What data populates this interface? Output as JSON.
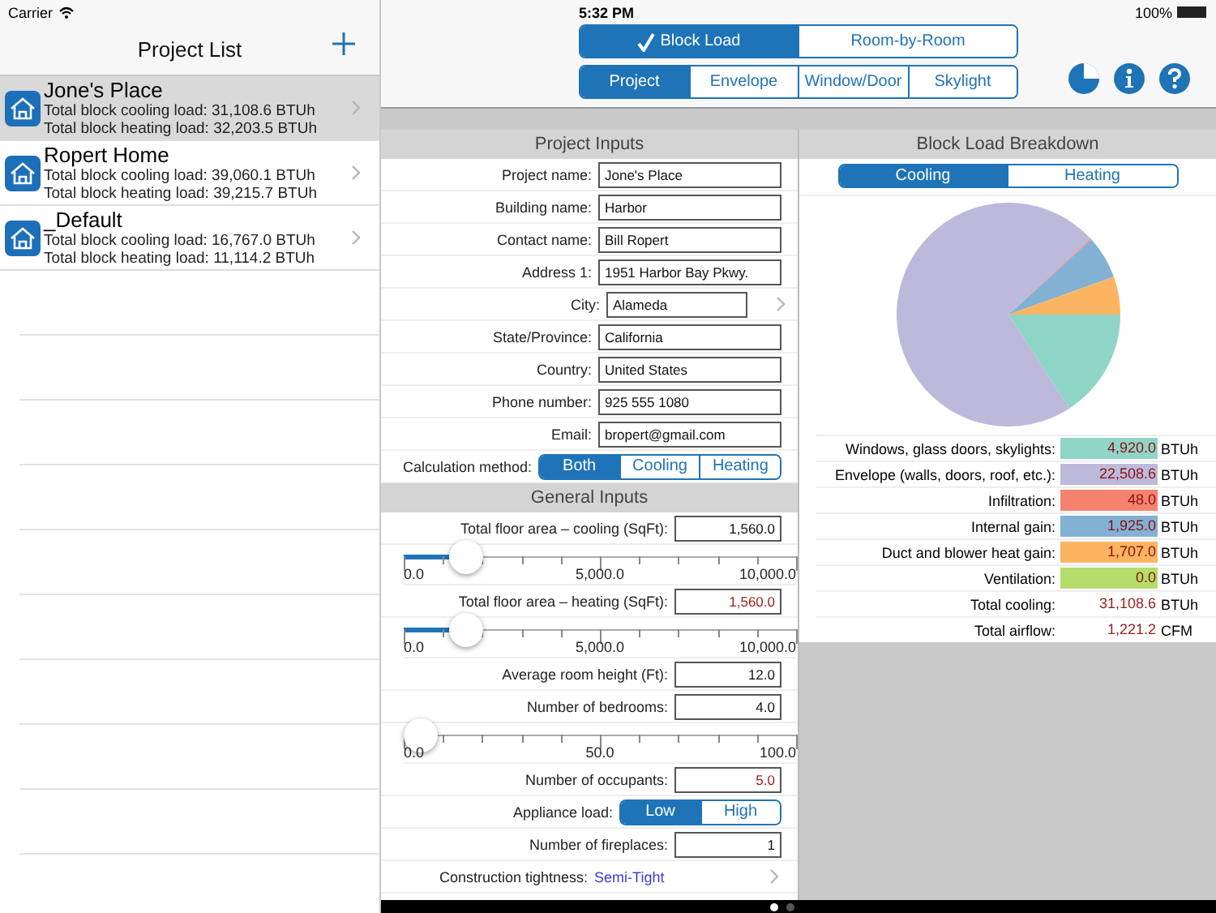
{
  "status_bar": {
    "carrier": "Carrier",
    "time": "5:32 PM",
    "battery": "100%"
  },
  "project_list": {
    "title": "Project List",
    "projects": [
      {
        "name": "Jone's Place",
        "cooling": "Total block cooling load: 31,108.6 BTUh",
        "heating": "Total block heating load: 32,203.5 BTUh",
        "selected": true
      },
      {
        "name": "Ropert Home",
        "cooling": "Total block cooling load: 39,060.1 BTUh",
        "heating": "Total block heating load: 39,215.7 BTUh",
        "selected": false
      },
      {
        "name": "_Default",
        "cooling": "Total block cooling load: 16,767.0 BTUh",
        "heating": "Total block heating load: 11,114.2 BTUh",
        "selected": false
      }
    ]
  },
  "mode_tabs": [
    {
      "label": "Block Load",
      "selected": true
    },
    {
      "label": "Room-by-Room",
      "selected": false
    }
  ],
  "section_tabs": [
    {
      "label": "Project",
      "selected": true
    },
    {
      "label": "Envelope",
      "selected": false
    },
    {
      "label": "Window/Door",
      "selected": false
    },
    {
      "label": "Skylight",
      "selected": false
    }
  ],
  "project_inputs": {
    "title": "Project Inputs",
    "fields": [
      {
        "kind": "text",
        "label": "Project name:",
        "value": "Jone's Place"
      },
      {
        "kind": "text",
        "label": "Building name:",
        "value": "Harbor"
      },
      {
        "kind": "text",
        "label": "Contact name:",
        "value": "Bill Ropert"
      },
      {
        "kind": "text",
        "label": "Address 1:",
        "value": "1951 Harbor Bay Pkwy."
      },
      {
        "kind": "picker",
        "label": "City:",
        "value": "Alameda"
      },
      {
        "kind": "text",
        "label": "State/Province:",
        "value": "California"
      },
      {
        "kind": "text",
        "label": "Country:",
        "value": "United States"
      },
      {
        "kind": "text",
        "label": "Phone number:",
        "value": "925 555 1080"
      },
      {
        "kind": "text",
        "label": "Email:",
        "value": "bropert@gmail.com"
      },
      {
        "kind": "segmented",
        "label": "Calculation method:",
        "options": [
          {
            "label": "Both",
            "selected": true
          },
          {
            "label": "Cooling",
            "selected": false
          },
          {
            "label": "Heating",
            "selected": false
          }
        ]
      }
    ]
  },
  "general_inputs": {
    "title": "General Inputs",
    "fields": [
      {
        "kind": "number",
        "label": "Total floor area – cooling (SqFt):",
        "value": "1,560.0",
        "derived": false
      },
      {
        "kind": "slider",
        "level": 0.156,
        "ticks": [
          "0.0",
          "5,000.0",
          "10,000.0"
        ]
      },
      {
        "kind": "number",
        "label": "Total floor area – heating (SqFt):",
        "value": "1,560.0",
        "derived": true
      },
      {
        "kind": "slider",
        "level": 0.156,
        "ticks": [
          "0.0",
          "5,000.0",
          "10,000.0"
        ]
      },
      {
        "kind": "number",
        "label": "Average room height (Ft):",
        "value": "12.0",
        "derived": false
      },
      {
        "kind": "number",
        "label": "Number of bedrooms:",
        "value": "4.0",
        "derived": false
      },
      {
        "kind": "slider",
        "level": 0.04,
        "ticks": [
          "0.0",
          "50.0",
          "100.0"
        ]
      },
      {
        "kind": "number",
        "label": "Number of occupants:",
        "value": "5.0",
        "derived": true
      },
      {
        "kind": "segmented",
        "label": "Appliance load:",
        "options": [
          {
            "label": "Low",
            "selected": true
          },
          {
            "label": "High",
            "selected": false
          }
        ]
      },
      {
        "kind": "number",
        "label": "Number of fireplaces:",
        "value": "1",
        "derived": false
      },
      {
        "kind": "link",
        "label": "Construction tightness:",
        "value": "Semi-Tight"
      }
    ]
  },
  "breakdown": {
    "title": "Block Load Breakdown",
    "tabs": [
      {
        "label": "Cooling",
        "selected": true
      },
      {
        "label": "Heating",
        "selected": false
      }
    ],
    "chart_data": {
      "type": "pie",
      "values": [
        15.816,
        72.355,
        0.154,
        6.188,
        5.487,
        0.0
      ]
    },
    "rows": [
      {
        "kind": "item",
        "label": "Windows, glass doors, skylights:",
        "value": "4,920.0",
        "unit": "BTUh",
        "color": "#8fd5c8"
      },
      {
        "kind": "item",
        "label": "Envelope (walls, doors, roof, etc.):",
        "value": "22,508.6",
        "unit": "BTUh",
        "color": "#bdb9da"
      },
      {
        "kind": "item",
        "label": "Infiltration:",
        "value": "48.0",
        "unit": "BTUh",
        "color": "#f5816f"
      },
      {
        "kind": "item",
        "label": "Internal gain:",
        "value": "1,925.0",
        "unit": "BTUh",
        "color": "#82b1d4"
      },
      {
        "kind": "item",
        "label": "Duct and blower heat gain:",
        "value": "1,707.0",
        "unit": "BTUh",
        "color": "#fbb462"
      },
      {
        "kind": "item",
        "label": "Ventilation:",
        "value": "0.0",
        "unit": "BTUh",
        "color": "#b4dd6c"
      },
      {
        "kind": "total",
        "label": "Total cooling:",
        "value": "31,108.6",
        "unit": "BTUh"
      },
      {
        "kind": "total",
        "label": "Total airflow:",
        "value": "1,221.2",
        "unit": "CFM"
      }
    ]
  },
  "pager": [
    {
      "selected": true
    },
    {
      "selected": false
    }
  ]
}
